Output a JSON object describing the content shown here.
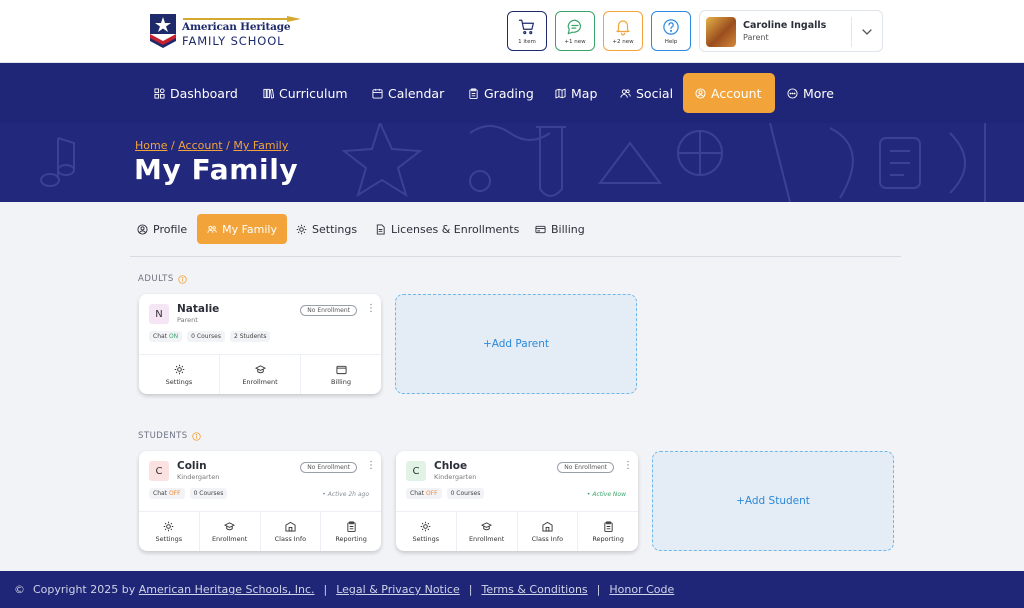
{
  "header": {
    "logo": {
      "line1": "American Heritage",
      "line2": "FAMILY SCHOOL",
      "icon": "star-flag-logo"
    },
    "cart": {
      "label": "1 item",
      "icon": "cart-icon"
    },
    "chat": {
      "label": "+1 new",
      "icon": "chat-icon"
    },
    "notifications": {
      "label": "+2 new",
      "icon": "bell-icon"
    },
    "help": {
      "label": "Help",
      "icon": "help-icon"
    },
    "user": {
      "name": "Caroline Ingalls",
      "role": "Parent"
    }
  },
  "nav": [
    {
      "label": "Dashboard",
      "icon": "dashboard-icon"
    },
    {
      "label": "Curriculum",
      "icon": "books-icon"
    },
    {
      "label": "Calendar",
      "icon": "calendar-icon"
    },
    {
      "label": "Grading",
      "icon": "clipboard-icon"
    },
    {
      "label": "Map",
      "icon": "map-icon"
    },
    {
      "label": "Social",
      "icon": "people-icon"
    },
    {
      "label": "Account",
      "icon": "account-icon",
      "active": true
    },
    {
      "label": "More",
      "icon": "more-icon"
    }
  ],
  "breadcrumb": {
    "home": "Home",
    "account": "Account",
    "current": "My Family",
    "sep": "/"
  },
  "page_title": "My Family",
  "tabs": [
    {
      "label": "Profile",
      "icon": "profile-icon"
    },
    {
      "label": "My Family",
      "icon": "family-icon",
      "active": true
    },
    {
      "label": "Settings",
      "icon": "gear-icon"
    },
    {
      "label": "Licenses & Enrollments",
      "icon": "document-icon"
    },
    {
      "label": "Billing",
      "icon": "card-icon"
    }
  ],
  "adults": {
    "heading": "ADULTS",
    "cards": [
      {
        "initial": "N",
        "name": "Natalie",
        "role": "Parent",
        "badge": "No Enrollment",
        "chat_label": "Chat",
        "chat_state": "ON",
        "courses": "0 Courses",
        "students": "2 Students",
        "actions": [
          "Settings",
          "Enrollment",
          "Billing"
        ]
      }
    ],
    "add_label": "+Add Parent"
  },
  "students": {
    "heading": "STUDENTS",
    "cards": [
      {
        "initial": "C",
        "name": "Colin",
        "role": "Kindergarten",
        "badge": "No Enrollment",
        "chat_label": "Chat",
        "chat_state": "OFF",
        "courses": "0 Courses",
        "status": "• Active 2h ago",
        "actions": [
          "Settings",
          "Enrollment",
          "Class Info",
          "Reporting"
        ]
      },
      {
        "initial": "C",
        "name": "Chloe",
        "role": "Kindergarten",
        "badge": "No Enrollment",
        "chat_label": "Chat",
        "chat_state": "OFF",
        "courses": "0 Courses",
        "status": "• Active Now",
        "actions": [
          "Settings",
          "Enrollment",
          "Class Info",
          "Reporting"
        ]
      }
    ],
    "add_label": "+Add Student"
  },
  "footer": {
    "symbol": "©",
    "copyright": "Copyright 2025 by",
    "company": "American Heritage Schools, Inc.",
    "links": [
      "Legal & Privacy Notice",
      "Terms & Conditions",
      "Honor Code"
    ],
    "sep": "|"
  },
  "colors": {
    "primary": "#1f2577",
    "accent": "#f2a43a",
    "link": "#2b88d8",
    "on": "#3aa56a",
    "off": "#f08a3a"
  }
}
